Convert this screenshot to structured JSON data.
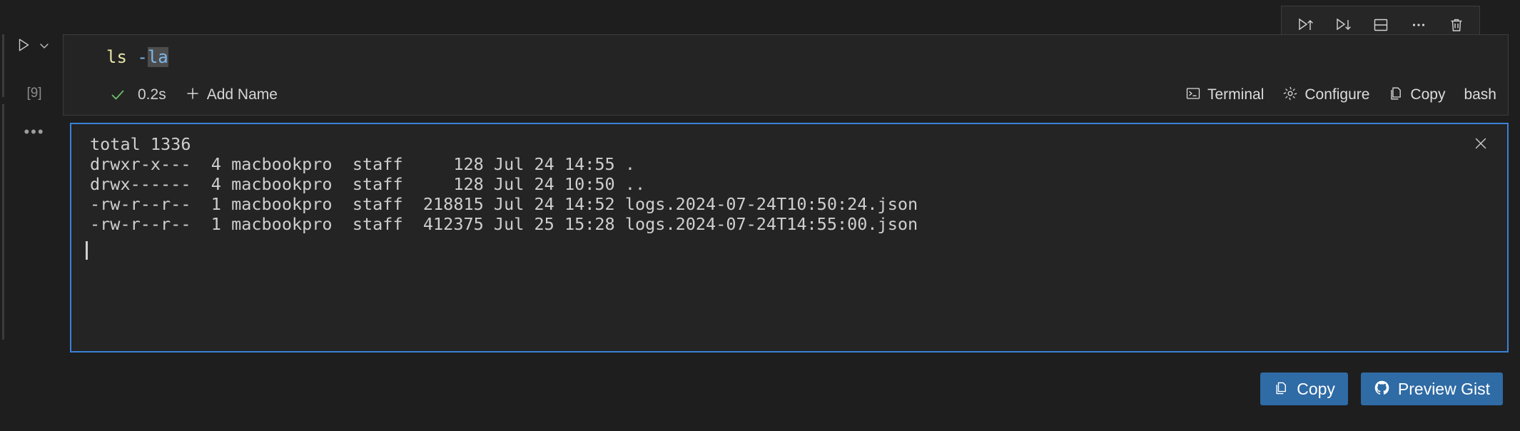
{
  "theme": {
    "background": "#1e1e1e",
    "cell_background": "#242424",
    "border": "#3c3c3c",
    "focus_border": "#3b81d8",
    "button_blue": "#2f6ba5",
    "success_green": "#6cc26c",
    "text": "#cfcfcf"
  },
  "toolbar": {
    "buttons": [
      {
        "name": "run-above-button",
        "icon": "play-up-icon",
        "title": "Execute Above Cells"
      },
      {
        "name": "run-below-button",
        "icon": "play-down-icon",
        "title": "Execute Cell and Below"
      },
      {
        "name": "split-cell-button",
        "icon": "split-cell-icon",
        "title": "Split Cell"
      },
      {
        "name": "more-actions-button",
        "icon": "ellipsis-icon",
        "title": "More Actions"
      },
      {
        "name": "delete-cell-button",
        "icon": "trash-icon",
        "title": "Delete Cell"
      }
    ]
  },
  "gutter": {
    "run_icon": "play-icon",
    "chevron_icon": "chevron-down-icon",
    "execution_count": "[9]",
    "output_ellipsis": "•••"
  },
  "cell": {
    "code": {
      "command": "ls",
      "flag_dash": "-",
      "flag_selected": "la"
    },
    "status": {
      "state_icon": "checkmark-icon",
      "duration": "0.2s",
      "add_name_icon": "plus-icon",
      "add_name_label": "Add Name"
    },
    "meta": [
      {
        "icon": "terminal-icon",
        "label": "Terminal"
      },
      {
        "icon": "gear-icon",
        "label": "Configure"
      },
      {
        "icon": "copy-icon",
        "label": "Copy"
      }
    ],
    "language": "bash"
  },
  "output": {
    "close_icon": "close-icon",
    "text": "total 1336\ndrwxr-x---  4 macbookpro  staff     128 Jul 24 14:55 .\ndrwx------  4 macbookpro  staff     128 Jul 24 10:50 ..\n-rw-r--r--  1 macbookpro  staff  218815 Jul 24 14:52 logs.2024-07-24T10:50:24.json\n-rw-r--r--  1 macbookpro  staff  412375 Jul 25 15:28 logs.2024-07-24T14:55:00.json",
    "lines": [
      "total 1336",
      "drwxr-x---  4 macbookpro  staff     128 Jul 24 14:55 .",
      "drwx------  4 macbookpro  staff     128 Jul 24 10:50 ..",
      "-rw-r--r--  1 macbookpro  staff  218815 Jul 24 14:52 logs.2024-07-24T10:50:24.json",
      "-rw-r--r--  1 macbookpro  staff  412375 Jul 25 15:28 logs.2024-07-24T14:55:00.json"
    ],
    "actions": [
      {
        "name": "copy-output-button",
        "icon": "copy-icon",
        "label": "Copy"
      },
      {
        "name": "preview-gist-button",
        "icon": "github-icon",
        "label": "Preview Gist"
      }
    ]
  }
}
